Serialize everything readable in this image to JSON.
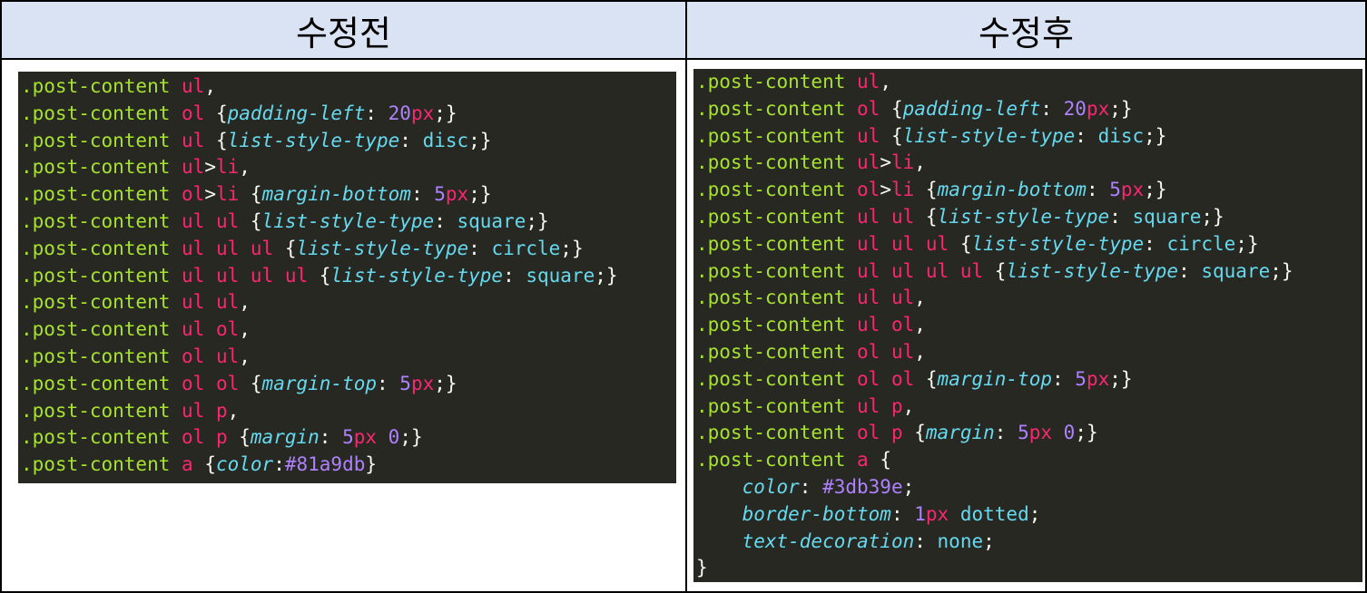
{
  "headers": {
    "before": "수정전",
    "after": "수정후"
  },
  "before_code": [
    [
      {
        "t": ".post-content",
        "c": "sel"
      },
      {
        "t": " ",
        "c": "pun"
      },
      {
        "t": "ul",
        "c": "tag"
      },
      {
        "t": ",",
        "c": "pun"
      }
    ],
    [
      {
        "t": ".post-content",
        "c": "sel"
      },
      {
        "t": " ",
        "c": "pun"
      },
      {
        "t": "ol",
        "c": "tag"
      },
      {
        "t": " {",
        "c": "pun"
      },
      {
        "t": "padding-left",
        "c": "prop"
      },
      {
        "t": ": ",
        "c": "pun"
      },
      {
        "t": "20",
        "c": "num"
      },
      {
        "t": "px",
        "c": "unit"
      },
      {
        "t": ";}",
        "c": "pun"
      }
    ],
    [
      {
        "t": ".post-content",
        "c": "sel"
      },
      {
        "t": " ",
        "c": "pun"
      },
      {
        "t": "ul",
        "c": "tag"
      },
      {
        "t": " {",
        "c": "pun"
      },
      {
        "t": "list-style-type",
        "c": "prop"
      },
      {
        "t": ": ",
        "c": "pun"
      },
      {
        "t": "disc",
        "c": "val"
      },
      {
        "t": ";}",
        "c": "pun"
      }
    ],
    [
      {
        "t": ".post-content",
        "c": "sel"
      },
      {
        "t": " ",
        "c": "pun"
      },
      {
        "t": "ul",
        "c": "tag"
      },
      {
        "t": ">",
        "c": "pun"
      },
      {
        "t": "li",
        "c": "tag"
      },
      {
        "t": ",",
        "c": "pun"
      }
    ],
    [
      {
        "t": ".post-content",
        "c": "sel"
      },
      {
        "t": " ",
        "c": "pun"
      },
      {
        "t": "ol",
        "c": "tag"
      },
      {
        "t": ">",
        "c": "pun"
      },
      {
        "t": "li",
        "c": "tag"
      },
      {
        "t": " {",
        "c": "pun"
      },
      {
        "t": "margin-bottom",
        "c": "prop"
      },
      {
        "t": ": ",
        "c": "pun"
      },
      {
        "t": "5",
        "c": "num"
      },
      {
        "t": "px",
        "c": "unit"
      },
      {
        "t": ";}",
        "c": "pun"
      }
    ],
    [
      {
        "t": ".post-content",
        "c": "sel"
      },
      {
        "t": " ",
        "c": "pun"
      },
      {
        "t": "ul ul",
        "c": "tag"
      },
      {
        "t": " {",
        "c": "pun"
      },
      {
        "t": "list-style-type",
        "c": "prop"
      },
      {
        "t": ": ",
        "c": "pun"
      },
      {
        "t": "square",
        "c": "val"
      },
      {
        "t": ";}",
        "c": "pun"
      }
    ],
    [
      {
        "t": ".post-content",
        "c": "sel"
      },
      {
        "t": " ",
        "c": "pun"
      },
      {
        "t": "ul ul ul",
        "c": "tag"
      },
      {
        "t": " {",
        "c": "pun"
      },
      {
        "t": "list-style-type",
        "c": "prop"
      },
      {
        "t": ": ",
        "c": "pun"
      },
      {
        "t": "circle",
        "c": "val"
      },
      {
        "t": ";}",
        "c": "pun"
      }
    ],
    [
      {
        "t": ".post-content",
        "c": "sel"
      },
      {
        "t": " ",
        "c": "pun"
      },
      {
        "t": "ul ul ul ul",
        "c": "tag"
      },
      {
        "t": " {",
        "c": "pun"
      },
      {
        "t": "list-style-type",
        "c": "prop"
      },
      {
        "t": ": ",
        "c": "pun"
      },
      {
        "t": "square",
        "c": "val"
      },
      {
        "t": ";}",
        "c": "pun"
      }
    ],
    [
      {
        "t": ".post-content",
        "c": "sel"
      },
      {
        "t": " ",
        "c": "pun"
      },
      {
        "t": "ul ul",
        "c": "tag"
      },
      {
        "t": ",",
        "c": "pun"
      }
    ],
    [
      {
        "t": ".post-content",
        "c": "sel"
      },
      {
        "t": " ",
        "c": "pun"
      },
      {
        "t": "ul ol",
        "c": "tag"
      },
      {
        "t": ",",
        "c": "pun"
      }
    ],
    [
      {
        "t": ".post-content",
        "c": "sel"
      },
      {
        "t": " ",
        "c": "pun"
      },
      {
        "t": "ol ul",
        "c": "tag"
      },
      {
        "t": ",",
        "c": "pun"
      }
    ],
    [
      {
        "t": ".post-content",
        "c": "sel"
      },
      {
        "t": " ",
        "c": "pun"
      },
      {
        "t": "ol ol",
        "c": "tag"
      },
      {
        "t": " {",
        "c": "pun"
      },
      {
        "t": "margin-top",
        "c": "prop"
      },
      {
        "t": ": ",
        "c": "pun"
      },
      {
        "t": "5",
        "c": "num"
      },
      {
        "t": "px",
        "c": "unit"
      },
      {
        "t": ";}",
        "c": "pun"
      }
    ],
    [
      {
        "t": ".post-content",
        "c": "sel"
      },
      {
        "t": " ",
        "c": "pun"
      },
      {
        "t": "ul p",
        "c": "tag"
      },
      {
        "t": ",",
        "c": "pun"
      }
    ],
    [
      {
        "t": ".post-content",
        "c": "sel"
      },
      {
        "t": " ",
        "c": "pun"
      },
      {
        "t": "ol p",
        "c": "tag"
      },
      {
        "t": " {",
        "c": "pun"
      },
      {
        "t": "margin",
        "c": "prop"
      },
      {
        "t": ": ",
        "c": "pun"
      },
      {
        "t": "5",
        "c": "num"
      },
      {
        "t": "px",
        "c": "unit"
      },
      {
        "t": " ",
        "c": "pun"
      },
      {
        "t": "0",
        "c": "num"
      },
      {
        "t": ";}",
        "c": "pun"
      }
    ],
    [
      {
        "t": ".post-content",
        "c": "sel"
      },
      {
        "t": " ",
        "c": "pun"
      },
      {
        "t": "a",
        "c": "tag"
      },
      {
        "t": " {",
        "c": "pun"
      },
      {
        "t": "color",
        "c": "prop"
      },
      {
        "t": ":",
        "c": "pun"
      },
      {
        "t": "#81a9db",
        "c": "num"
      },
      {
        "t": "}",
        "c": "pun"
      }
    ]
  ],
  "after_code": [
    [
      {
        "t": ".post-content",
        "c": "sel"
      },
      {
        "t": " ",
        "c": "pun"
      },
      {
        "t": "ul",
        "c": "tag"
      },
      {
        "t": ",",
        "c": "pun"
      }
    ],
    [
      {
        "t": ".post-content",
        "c": "sel"
      },
      {
        "t": " ",
        "c": "pun"
      },
      {
        "t": "ol",
        "c": "tag"
      },
      {
        "t": " {",
        "c": "pun"
      },
      {
        "t": "padding-left",
        "c": "prop"
      },
      {
        "t": ": ",
        "c": "pun"
      },
      {
        "t": "20",
        "c": "num"
      },
      {
        "t": "px",
        "c": "unit"
      },
      {
        "t": ";}",
        "c": "pun"
      }
    ],
    [
      {
        "t": ".post-content",
        "c": "sel"
      },
      {
        "t": " ",
        "c": "pun"
      },
      {
        "t": "ul",
        "c": "tag"
      },
      {
        "t": " {",
        "c": "pun"
      },
      {
        "t": "list-style-type",
        "c": "prop"
      },
      {
        "t": ": ",
        "c": "pun"
      },
      {
        "t": "disc",
        "c": "val"
      },
      {
        "t": ";}",
        "c": "pun"
      }
    ],
    [
      {
        "t": ".post-content",
        "c": "sel"
      },
      {
        "t": " ",
        "c": "pun"
      },
      {
        "t": "ul",
        "c": "tag"
      },
      {
        "t": ">",
        "c": "pun"
      },
      {
        "t": "li",
        "c": "tag"
      },
      {
        "t": ",",
        "c": "pun"
      }
    ],
    [
      {
        "t": ".post-content",
        "c": "sel"
      },
      {
        "t": " ",
        "c": "pun"
      },
      {
        "t": "ol",
        "c": "tag"
      },
      {
        "t": ">",
        "c": "pun"
      },
      {
        "t": "li",
        "c": "tag"
      },
      {
        "t": " {",
        "c": "pun"
      },
      {
        "t": "margin-bottom",
        "c": "prop"
      },
      {
        "t": ": ",
        "c": "pun"
      },
      {
        "t": "5",
        "c": "num"
      },
      {
        "t": "px",
        "c": "unit"
      },
      {
        "t": ";}",
        "c": "pun"
      }
    ],
    [
      {
        "t": ".post-content",
        "c": "sel"
      },
      {
        "t": " ",
        "c": "pun"
      },
      {
        "t": "ul ul",
        "c": "tag"
      },
      {
        "t": " {",
        "c": "pun"
      },
      {
        "t": "list-style-type",
        "c": "prop"
      },
      {
        "t": ": ",
        "c": "pun"
      },
      {
        "t": "square",
        "c": "val"
      },
      {
        "t": ";}",
        "c": "pun"
      }
    ],
    [
      {
        "t": ".post-content",
        "c": "sel"
      },
      {
        "t": " ",
        "c": "pun"
      },
      {
        "t": "ul ul ul",
        "c": "tag"
      },
      {
        "t": " {",
        "c": "pun"
      },
      {
        "t": "list-style-type",
        "c": "prop"
      },
      {
        "t": ": ",
        "c": "pun"
      },
      {
        "t": "circle",
        "c": "val"
      },
      {
        "t": ";}",
        "c": "pun"
      }
    ],
    [
      {
        "t": ".post-content",
        "c": "sel"
      },
      {
        "t": " ",
        "c": "pun"
      },
      {
        "t": "ul ul ul ul",
        "c": "tag"
      },
      {
        "t": " {",
        "c": "pun"
      },
      {
        "t": "list-style-type",
        "c": "prop"
      },
      {
        "t": ": ",
        "c": "pun"
      },
      {
        "t": "square",
        "c": "val"
      },
      {
        "t": ";}",
        "c": "pun"
      }
    ],
    [
      {
        "t": ".post-content",
        "c": "sel"
      },
      {
        "t": " ",
        "c": "pun"
      },
      {
        "t": "ul ul",
        "c": "tag"
      },
      {
        "t": ",",
        "c": "pun"
      }
    ],
    [
      {
        "t": ".post-content",
        "c": "sel"
      },
      {
        "t": " ",
        "c": "pun"
      },
      {
        "t": "ul ol",
        "c": "tag"
      },
      {
        "t": ",",
        "c": "pun"
      }
    ],
    [
      {
        "t": ".post-content",
        "c": "sel"
      },
      {
        "t": " ",
        "c": "pun"
      },
      {
        "t": "ol ul",
        "c": "tag"
      },
      {
        "t": ",",
        "c": "pun"
      }
    ],
    [
      {
        "t": ".post-content",
        "c": "sel"
      },
      {
        "t": " ",
        "c": "pun"
      },
      {
        "t": "ol ol",
        "c": "tag"
      },
      {
        "t": " {",
        "c": "pun"
      },
      {
        "t": "margin-top",
        "c": "prop"
      },
      {
        "t": ": ",
        "c": "pun"
      },
      {
        "t": "5",
        "c": "num"
      },
      {
        "t": "px",
        "c": "unit"
      },
      {
        "t": ";}",
        "c": "pun"
      }
    ],
    [
      {
        "t": ".post-content",
        "c": "sel"
      },
      {
        "t": " ",
        "c": "pun"
      },
      {
        "t": "ul p",
        "c": "tag"
      },
      {
        "t": ",",
        "c": "pun"
      }
    ],
    [
      {
        "t": ".post-content",
        "c": "sel"
      },
      {
        "t": " ",
        "c": "pun"
      },
      {
        "t": "ol p",
        "c": "tag"
      },
      {
        "t": " {",
        "c": "pun"
      },
      {
        "t": "margin",
        "c": "prop"
      },
      {
        "t": ": ",
        "c": "pun"
      },
      {
        "t": "5",
        "c": "num"
      },
      {
        "t": "px",
        "c": "unit"
      },
      {
        "t": " ",
        "c": "pun"
      },
      {
        "t": "0",
        "c": "num"
      },
      {
        "t": ";}",
        "c": "pun"
      }
    ],
    [
      {
        "t": ".post-content",
        "c": "sel"
      },
      {
        "t": " ",
        "c": "pun"
      },
      {
        "t": "a",
        "c": "tag"
      },
      {
        "t": " {",
        "c": "pun"
      }
    ],
    [
      {
        "t": "    ",
        "c": "pun"
      },
      {
        "t": "color",
        "c": "prop"
      },
      {
        "t": ": ",
        "c": "pun"
      },
      {
        "t": "#3db39e",
        "c": "num"
      },
      {
        "t": ";",
        "c": "pun"
      }
    ],
    [
      {
        "t": "    ",
        "c": "pun"
      },
      {
        "t": "border-bottom",
        "c": "prop"
      },
      {
        "t": ": ",
        "c": "pun"
      },
      {
        "t": "1",
        "c": "num"
      },
      {
        "t": "px",
        "c": "unit"
      },
      {
        "t": " ",
        "c": "pun"
      },
      {
        "t": "dotted",
        "c": "val"
      },
      {
        "t": ";",
        "c": "pun"
      }
    ],
    [
      {
        "t": "    ",
        "c": "pun"
      },
      {
        "t": "text-decoration",
        "c": "prop"
      },
      {
        "t": ": ",
        "c": "pun"
      },
      {
        "t": "none",
        "c": "val"
      },
      {
        "t": ";",
        "c": "pun"
      }
    ],
    [
      {
        "t": "}",
        "c": "pun"
      }
    ]
  ],
  "colors": {
    "code_background": "#272822",
    "header_background": "#dae3f3",
    "selector": "#a6e22e",
    "tag": "#f92672",
    "property": "#66d9ef",
    "number": "#ae81ff"
  }
}
